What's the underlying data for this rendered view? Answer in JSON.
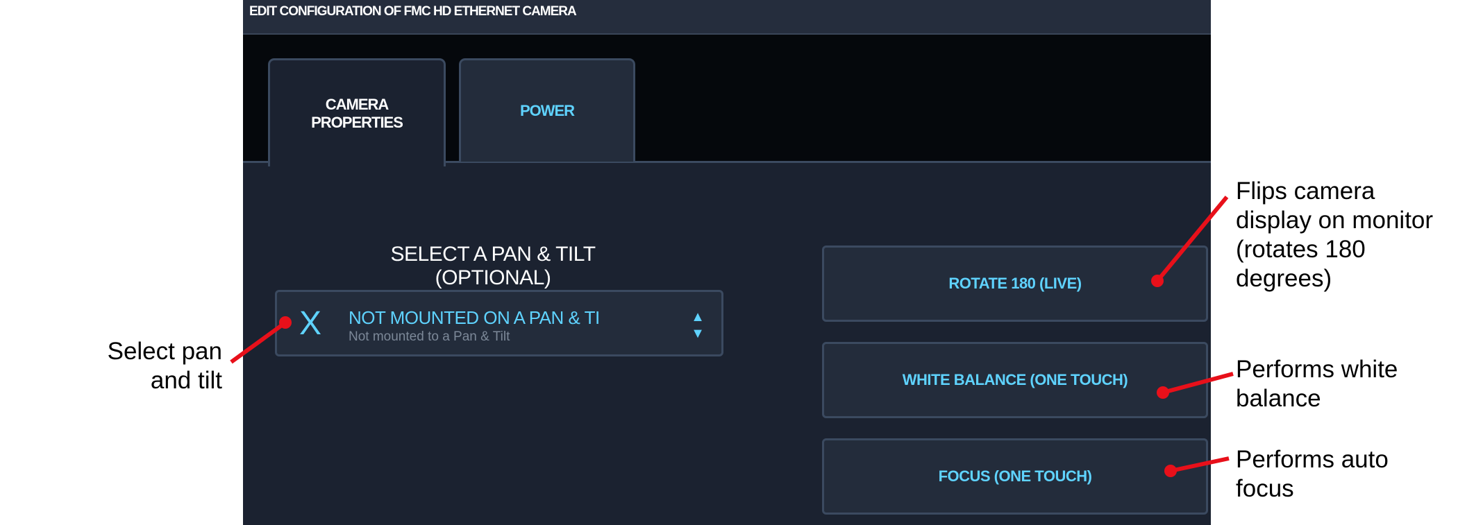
{
  "window": {
    "title": "EDIT CONFIGURATION OF FMC HD ETHERNET CAMERA"
  },
  "tabs": [
    {
      "label": "CAMERA\nPROPERTIES",
      "active": true
    },
    {
      "label": "POWER",
      "active": false
    }
  ],
  "pan_tilt": {
    "heading": "SELECT A PAN & TILT (OPTIONAL)",
    "selected_icon": "X",
    "selected_title": "NOT MOUNTED ON A PAN & TI",
    "selected_subtitle": "Not mounted to a Pan & Tilt",
    "stepper_icon": "up-down-arrows-icon"
  },
  "buttons": {
    "rotate": "ROTATE 180 (LIVE)",
    "white_balance": "WHITE BALANCE (ONE TOUCH)",
    "focus": "FOCUS (ONE TOUCH)"
  },
  "annotations": {
    "pan_tilt": "Select pan and tilt",
    "rotate": "Flips camera display on monitor (rotates 180 degrees)",
    "white_balance": "Performs white balance",
    "focus": "Performs auto focus"
  },
  "colors": {
    "accent": "#5fd3ff",
    "panel_bg": "#1b2230",
    "tab_bg": "#05080c",
    "annotation_line": "#e8101a"
  }
}
